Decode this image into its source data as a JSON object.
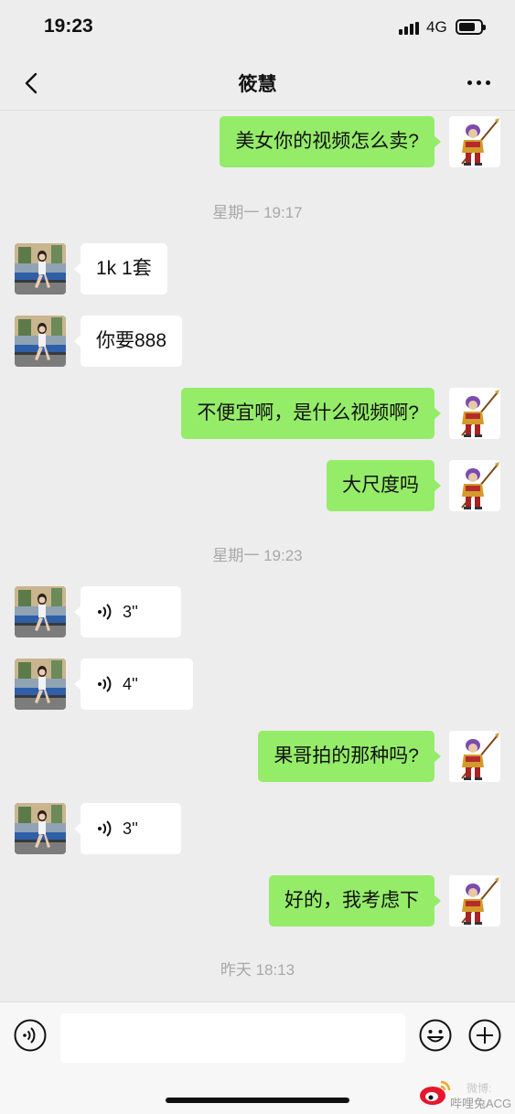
{
  "status": {
    "time": "19:23",
    "network": "4G",
    "battery_level": 0.75
  },
  "nav": {
    "title": "筱慧",
    "back_icon": "chevron-left-icon",
    "more_icon": "more-dots-icon"
  },
  "messages": [
    {
      "type": "text",
      "from": "me",
      "text": "美女你的视频怎么卖?"
    },
    {
      "type": "time",
      "text": "星期一 19:17"
    },
    {
      "type": "text",
      "from": "her",
      "text": "1k 1套"
    },
    {
      "type": "text",
      "from": "her",
      "text": "你要888"
    },
    {
      "type": "text",
      "from": "me",
      "text": "不便宜啊，是什么视频啊?"
    },
    {
      "type": "text",
      "from": "me",
      "text": "大尺度吗"
    },
    {
      "type": "time",
      "text": "星期一 19:23"
    },
    {
      "type": "voice",
      "from": "her",
      "text": "3''"
    },
    {
      "type": "voice",
      "from": "her",
      "text": "4''"
    },
    {
      "type": "text",
      "from": "me",
      "text": "果哥拍的那种吗?"
    },
    {
      "type": "voice",
      "from": "her",
      "text": "3''"
    },
    {
      "type": "text",
      "from": "me",
      "text": "好的，我考虑下"
    },
    {
      "type": "time",
      "text": "昨天 18:13"
    }
  ],
  "input": {
    "value": "",
    "voice_icon": "voice-mode-icon",
    "emoji_icon": "emoji-icon",
    "plus_icon": "plus-icon"
  },
  "watermark": {
    "line1": "微博:",
    "line2": "哔哩兔ACG"
  },
  "colors": {
    "background": "#ededed",
    "outgoing_bubble": "#95ec69",
    "incoming_bubble": "#ffffff",
    "timestamp": "#a8a8a8"
  }
}
